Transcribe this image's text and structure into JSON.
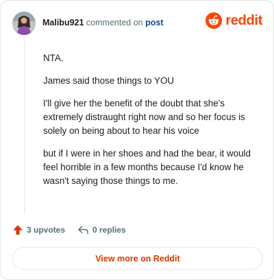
{
  "header": {
    "username": "Malibu921",
    "action_text": "commented on",
    "post_link": "post",
    "brand": "reddit"
  },
  "comment": {
    "paragraphs": [
      "NTA.",
      "James said those things to YOU",
      "I'll give her the benefit of the doubt that she's extremely distraught right now and so her focus is solely on being about to hear his voice",
      "but if I were in her shoes and had the bear, it would feel horrible in a few months because I'd know he wasn't saying those things to me."
    ]
  },
  "actions": {
    "upvotes": "3 upvotes",
    "replies": "0 replies"
  },
  "footer": {
    "view_more": "View more on Reddit"
  },
  "colors": {
    "accent": "#ff4500",
    "link": "#0a4d8c",
    "muted": "#576f76"
  }
}
